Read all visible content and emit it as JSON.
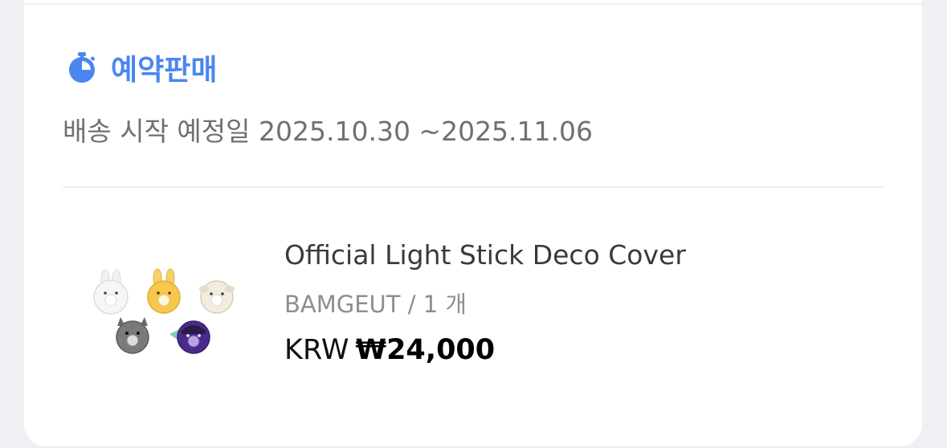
{
  "preorder": {
    "label": "예약판매",
    "icon": "timer-icon",
    "accent_color": "#4a86f0"
  },
  "shipping": {
    "text": "배송 시작 예정일 2025.10.30 ~2025.11.06"
  },
  "product": {
    "name": "Official Light Stick Deco Cover",
    "option": "BAMGEUT / 1 개",
    "currency": "KRW",
    "price": "₩24,000",
    "thumbnail": "light-stick-deco-covers-image"
  }
}
